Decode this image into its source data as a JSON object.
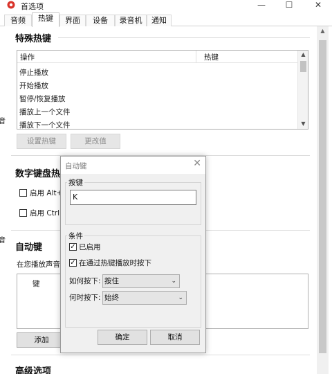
{
  "window": {
    "title": "首选项",
    "minimize": "—",
    "maximize": "☐",
    "close": "✕"
  },
  "tabs": [
    {
      "label": "音频"
    },
    {
      "label": "热键"
    },
    {
      "label": "界面"
    },
    {
      "label": "设备"
    },
    {
      "label": "录音机"
    },
    {
      "label": "通知"
    }
  ],
  "hotkeys_group": {
    "title": "特殊热键",
    "columns": [
      "操作",
      "热键"
    ],
    "rows": [
      "停止播放",
      "开始播放",
      "暂停/恢复播放",
      "播放上一个文件",
      "播放下一个文件"
    ],
    "set_hotkey_button": "设置热键",
    "change_value_button": "更改值"
  },
  "numpad_group": {
    "title": "数字键盘热",
    "alt_label": "启用 Alt+",
    "ctrl_label": "启用 Ctrl+"
  },
  "autokey_group": {
    "title": "自动键",
    "description": "在您播放声音时",
    "column_key": "键",
    "add_button": "添加"
  },
  "advanced_group": {
    "title": "高级选项"
  },
  "left_edge_text": [
    "音",
    "音"
  ],
  "dialog": {
    "title": "自动键",
    "key_legend": "按键",
    "key_value": "K",
    "conditions_legend": "条件",
    "enabled_label": "已启用",
    "enabled_checked": true,
    "hotkey_press_label": "在通过热键播放时按下",
    "hotkey_press_checked": true,
    "how_label": "如何按下:",
    "how_value": "按住",
    "when_label": "何时按下:",
    "when_value": "始终",
    "ok_button": "确定",
    "cancel_button": "取消"
  },
  "colors": {
    "accent_icon": "#d9342b",
    "disabled_text": "#8a8a8a"
  }
}
